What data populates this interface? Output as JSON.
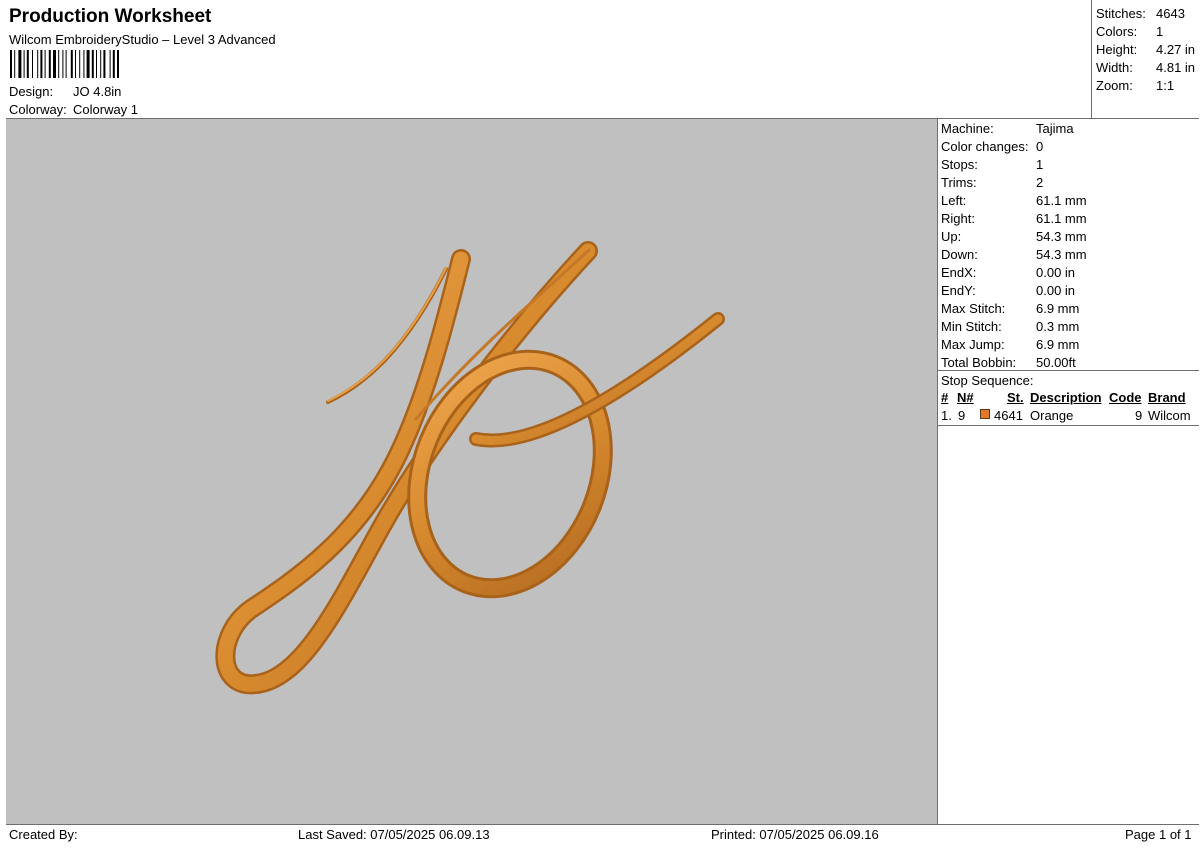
{
  "header": {
    "title": "Production Worksheet",
    "subtitle": "Wilcom EmbroideryStudio – Level 3 Advanced",
    "design_label": "Design:",
    "design_value": "JO 4.8in",
    "colorway_label": "Colorway:",
    "colorway_value": "Colorway 1"
  },
  "summary": {
    "stitches_label": "Stitches:",
    "stitches": "4643",
    "colors_label": "Colors:",
    "colors": "1",
    "height_label": "Height:",
    "height": "4.27 in",
    "width_label": "Width:",
    "width": "4.81 in",
    "zoom_label": "Zoom:",
    "zoom": "1:1"
  },
  "properties": [
    {
      "label": "Machine:",
      "value": "Tajima"
    },
    {
      "label": "Color changes:",
      "value": "0"
    },
    {
      "label": "Stops:",
      "value": "1"
    },
    {
      "label": "Trims:",
      "value": "2"
    },
    {
      "label": "Left:",
      "value": "61.1 mm"
    },
    {
      "label": "Right:",
      "value": "61.1 mm"
    },
    {
      "label": "Up:",
      "value": "54.3 mm"
    },
    {
      "label": "Down:",
      "value": "54.3 mm"
    },
    {
      "label": "EndX:",
      "value": "0.00 in"
    },
    {
      "label": "EndY:",
      "value": "0.00 in"
    },
    {
      "label": "Max Stitch:",
      "value": "6.9 mm"
    },
    {
      "label": "Min Stitch:",
      "value": "0.3 mm"
    },
    {
      "label": "Max Jump:",
      "value": "6.9 mm"
    },
    {
      "label": "Total Bobbin:",
      "value": "50.00ft"
    }
  ],
  "stop_sequence": {
    "title": "Stop Sequence:",
    "headers": {
      "num": "#",
      "n": "N#",
      "st": "St.",
      "description": "Description",
      "code": "Code",
      "brand": "Brand"
    },
    "rows": [
      {
        "num": "1.",
        "n": "9",
        "st": "4641",
        "description": "Orange",
        "code": "9",
        "brand": "Wilcom",
        "color": "#e07a2a"
      }
    ]
  },
  "footer": {
    "created_by": "Created By:",
    "last_saved": "Last Saved: 07/05/2025 06.09.13",
    "printed": "Printed: 07/05/2025 06.09.16",
    "page": "Page 1 of 1"
  },
  "colors": {
    "canvas_bg": "#c0c0c0",
    "thread": "#d88a2e",
    "thread_shadow": "#a8621a",
    "thread_highlight": "#f0a850"
  }
}
